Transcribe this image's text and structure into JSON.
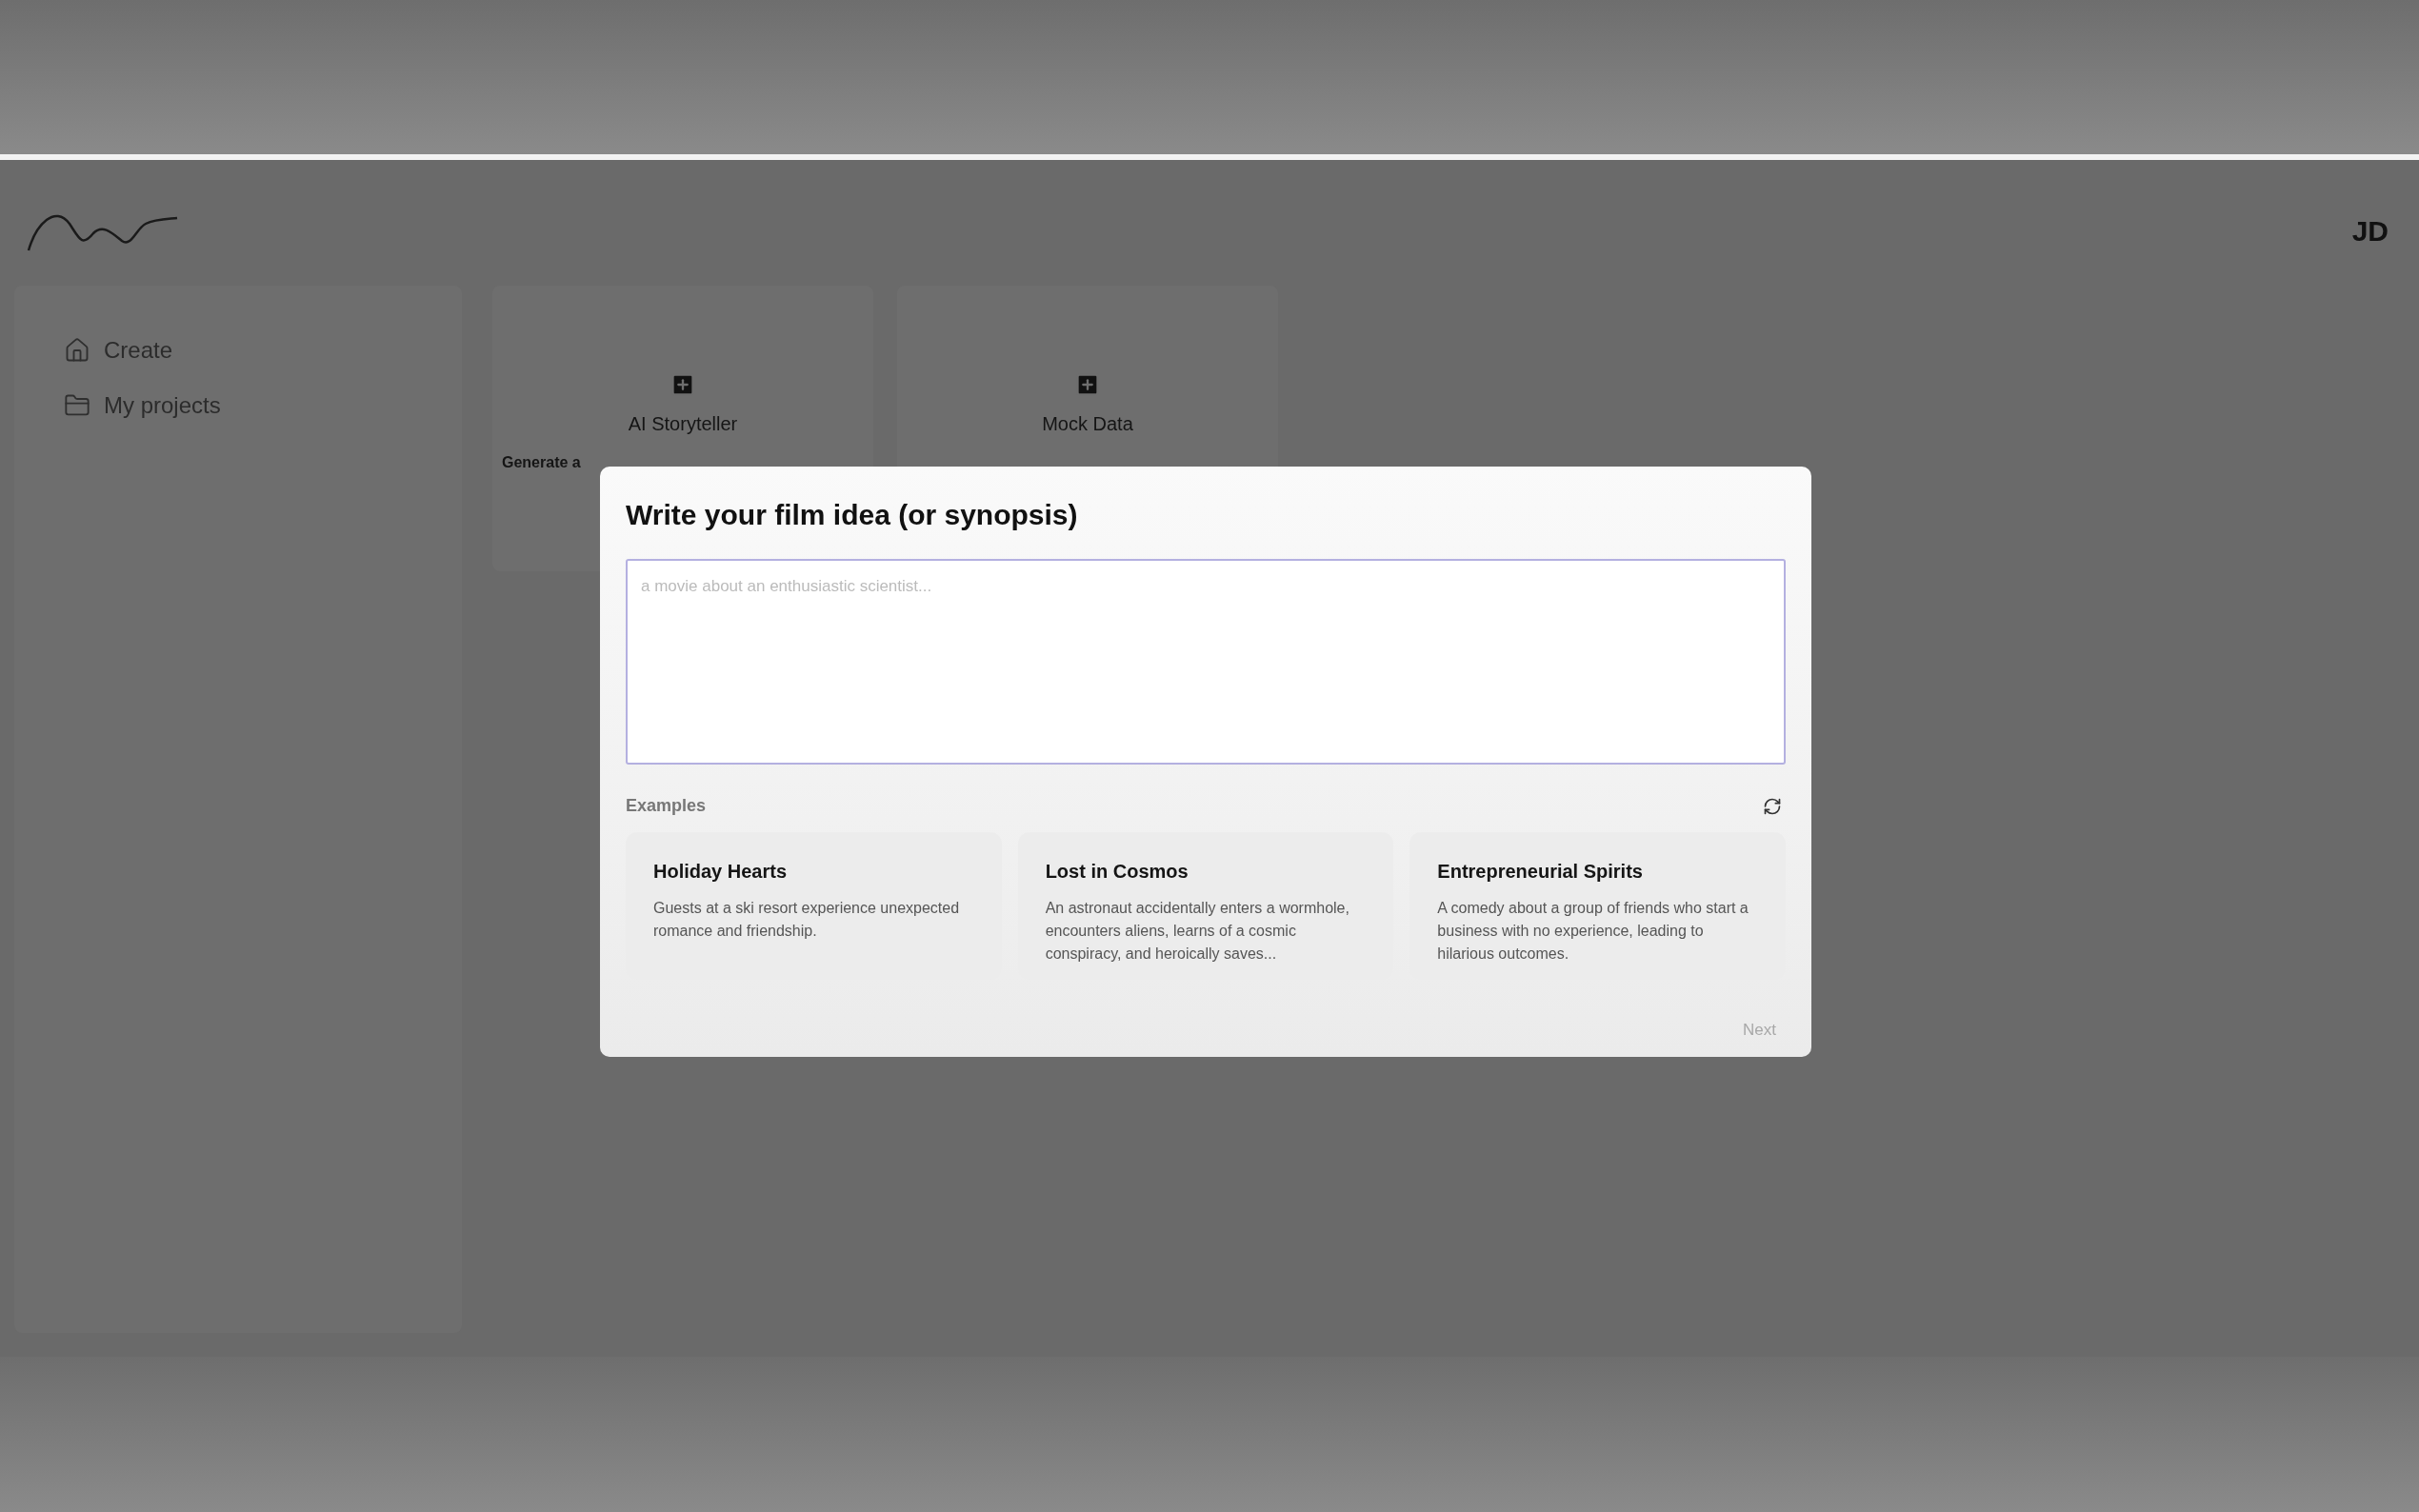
{
  "header": {
    "avatar": "JD"
  },
  "sidebar": {
    "items": [
      {
        "label": "Create"
      },
      {
        "label": "My projects"
      }
    ]
  },
  "tools": [
    {
      "title": "AI Storyteller",
      "description": "Generate a"
    },
    {
      "title": "Mock Data"
    }
  ],
  "modal": {
    "title": "Write your film idea (or synopsis)",
    "placeholder": "a movie about an enthusiastic scientist...",
    "examples_label": "Examples",
    "examples": [
      {
        "title": "Holiday Hearts",
        "description": "Guests at a ski resort experience unexpected romance and friendship."
      },
      {
        "title": "Lost in Cosmos",
        "description": "An astronaut accidentally enters a wormhole, encounters aliens, learns of a cosmic conspiracy, and heroically saves..."
      },
      {
        "title": "Entrepreneurial Spirits",
        "description": "A comedy about a group of friends who start a business with no experience, leading to hilarious outcomes."
      }
    ],
    "next": {
      "label": "Next",
      "disabled": true
    }
  }
}
